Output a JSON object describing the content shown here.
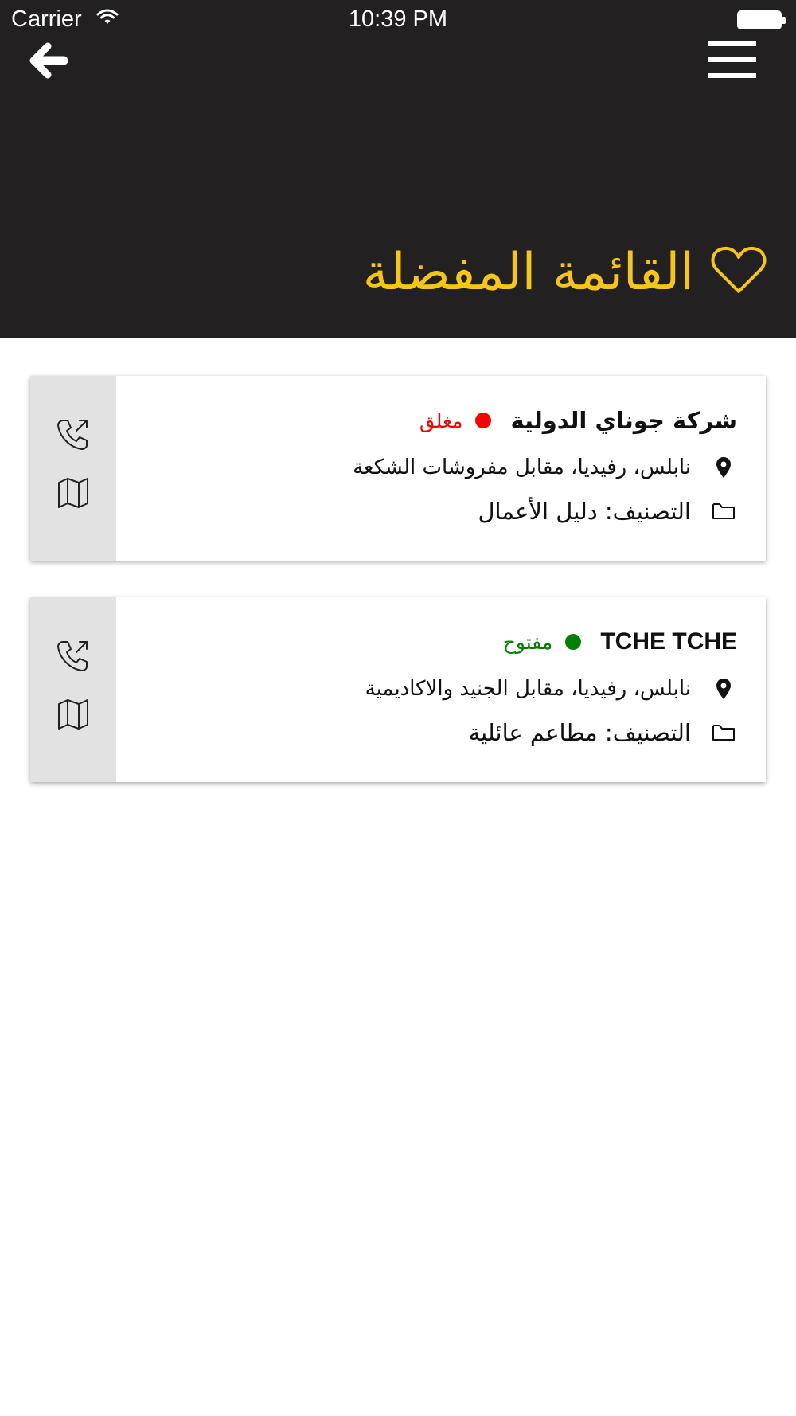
{
  "status_bar": {
    "carrier": "Carrier",
    "time": "10:39 PM",
    "icons": [
      "wifi-icon",
      "battery-icon"
    ]
  },
  "nav": {
    "back_icon": "arrow-left-icon",
    "menu_icon": "hamburger-menu-icon"
  },
  "header": {
    "title": "القائمة المفضلة",
    "title_icon": "heart-outline-icon",
    "background_color": "#222021",
    "accent_color": "#f5c518"
  },
  "favorites": [
    {
      "name": "شركة جوناي الدولية",
      "status": "مغلق",
      "status_color": "#ff0000",
      "address": "نابلس، رفيديا، مقابل مفروشات الشكعة",
      "category": "التصنيف: دليل الأعمال",
      "actions": [
        "phone-call-icon",
        "map-icon"
      ]
    },
    {
      "name": "TCHE TCHE",
      "status": "مفتوح",
      "status_color": "#008000",
      "address": "نابلس، رفيديا، مقابل الجنيد والاكاديمية",
      "category": "التصنيف: مطاعم عائلية",
      "actions": [
        "phone-call-icon",
        "map-icon"
      ]
    }
  ]
}
